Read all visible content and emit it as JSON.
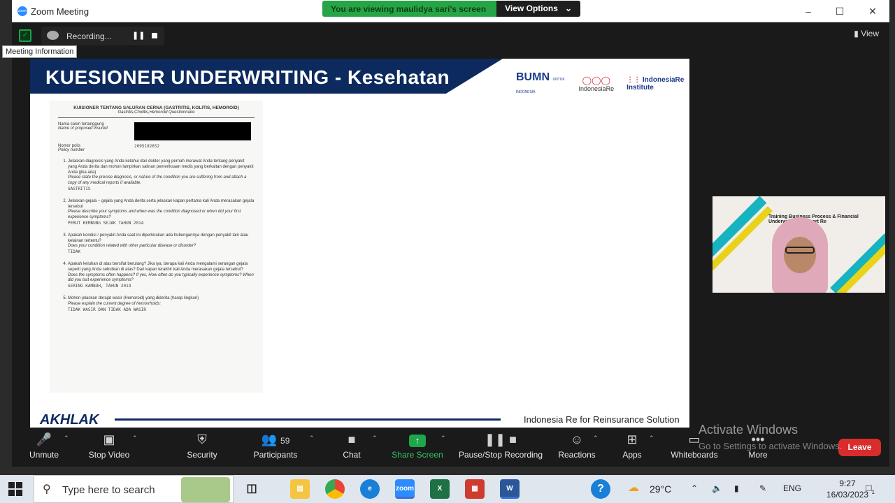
{
  "window": {
    "title": "Zoom Meeting",
    "app_icon": "zoom"
  },
  "share_banner": {
    "message": "You are viewing maulidya sari's screen",
    "view_options": "View Options"
  },
  "recording": {
    "label": "Recording..."
  },
  "tooltip": "Meeting Information",
  "view_button": "View",
  "slide": {
    "title": "KUESIONER UNDERWRITING - Kesehatan",
    "logo_bumn": "BUMN",
    "logo_bumn_small": "UNTUK INDONESIA",
    "logo_indonesiare": "IndonesiaRe",
    "logo_institute": "IndonesiaRe Institute",
    "footer_left": "AKHLAK",
    "footer_right": "Indonesia Re for Reinsurance Solution",
    "doc": {
      "header": "KUISIONER TENTANG SALURAN CERNA (GASTRITIS, KOLITIS, HEMOROID)",
      "subheader": "Gastritis,Cholitis,Hemoroid Questionnaire",
      "name_label": "Nama calon tertanggung",
      "name_label_en": "Name of proposed insured",
      "policy_label": "Nomor polis",
      "policy_label_en": "Policy number",
      "policy_value": "2095192652",
      "questions": [
        {
          "text": "Jelaskan diagnosis yang Anda ketahui dari dokter yang pernah merawat Anda tentang penyakit yang Anda derita dan mohon lampirkan salinan pemeriksaan medis yang berkaitan dengan penyakit Anda (jika ada)",
          "en": "Please state the precise diagnosis, or nature of the condition you are suffering from and attach a copy of any medical reports if available.",
          "answer": "GASTRITIS"
        },
        {
          "text": "Jelaskan gejala – gejala yang Anda derita serta jelaskan kapan pertama kali Anda merasakan gejala tersebut",
          "en": "Please describe your symptoms and when was the condition diagnosed or when did your first experience symptoms?",
          "answer": "PERUT KEMBUNG SEJAK TAHUN 2014"
        },
        {
          "text": "Apakah kondisi / penyakit Anda saat ini diperkirakan ada hubungannya dengan penyakit lain atau kelainan tertentu?",
          "en": "Does your condition related with other particular disease or disorder?",
          "answer": "TIDAK"
        },
        {
          "text": "Apakah keluhan di atas bersifat berulang? Jika iya, berapa kali Anda mengalami serangan gejala seperti yang Anda sebutkan di atas? Dari kapan terakhir kali Anda merasakan gejala tersebut?",
          "en": "Does the symptoms often happens? If yes, How often do you typically experience symptoms? When did you last experience symptoms?",
          "answer": "SERING KAMBUH, TAHUN 2014"
        },
        {
          "text": "Mohon jelaskan derajat wasir (Hemoroid) yang diderita (harap lingkari)",
          "en": "Please explain the current degree of hemorrhoids:",
          "answer": "TIDAK WASIR DAN TIDAK ADA WASIR"
        }
      ]
    }
  },
  "video_tile": {
    "text": "Training Business Process & Financial Underwriting Support Re"
  },
  "toolbar": {
    "unmute": "Unmute",
    "stop_video": "Stop Video",
    "security": "Security",
    "participants": "Participants",
    "participants_count": "59",
    "chat": "Chat",
    "share_screen": "Share Screen",
    "pause_stop_recording": "Pause/Stop Recording",
    "reactions": "Reactions",
    "apps": "Apps",
    "whiteboards": "Whiteboards",
    "more": "More",
    "leave": "Leave"
  },
  "watermark": {
    "line1": "Activate Windows",
    "line2": "Go to Settings to activate Windows."
  },
  "taskbar": {
    "search_placeholder": "Type here to search",
    "temperature": "29°C",
    "language": "ENG",
    "time": "9:27",
    "date": "16/03/2023",
    "notifications": "1"
  }
}
